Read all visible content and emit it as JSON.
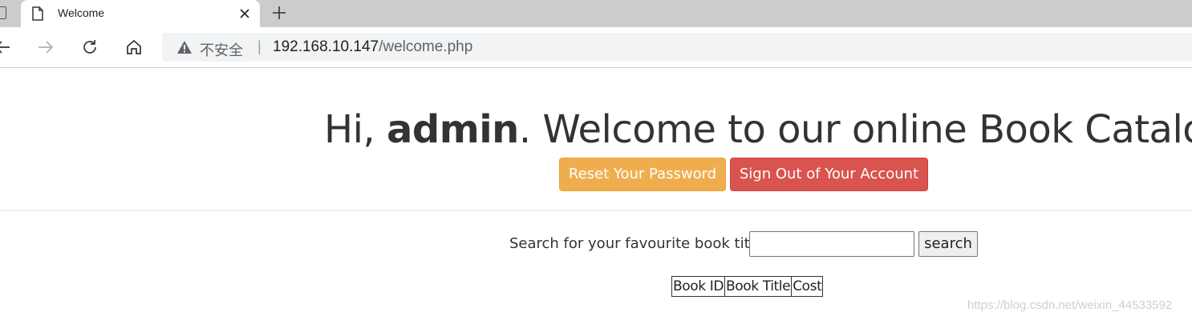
{
  "browser": {
    "tab_title": "Welcome",
    "insecure_label": "不安全",
    "separator": "|",
    "url_host": "192.168.10.147",
    "url_path": "/welcome.php"
  },
  "header": {
    "greeting_prefix": "Hi, ",
    "username": "admin",
    "greeting_suffix": ". Welcome to our online Book Catalog.",
    "reset_label": "Reset Your Password",
    "signout_label": "Sign Out of Your Account"
  },
  "search": {
    "label": "Search for your favourite book title",
    "input_value": "",
    "button_label": "search"
  },
  "table": {
    "columns": [
      "Book ID",
      "Book Title",
      "Cost"
    ]
  },
  "watermark": "https://blog.csdn.net/weixin_44533592",
  "colors": {
    "warning": "#f0ad4e",
    "danger": "#d9534f"
  },
  "icons": [
    "page-icon",
    "document-icon",
    "close-icon",
    "plus-icon",
    "back-arrow-icon",
    "forward-arrow-icon",
    "reload-icon",
    "home-icon",
    "warning-icon"
  ]
}
